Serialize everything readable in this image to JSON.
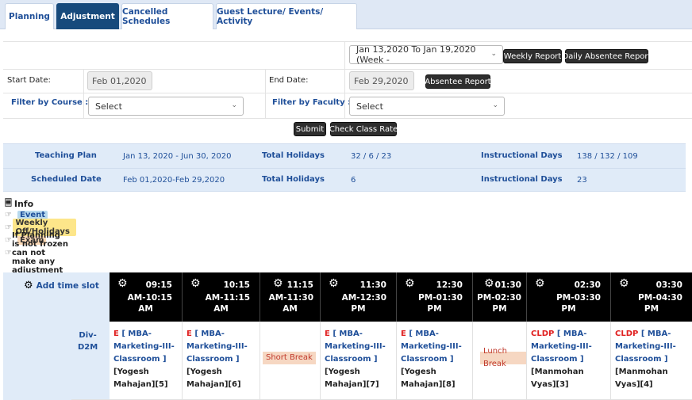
{
  "tabs": [
    {
      "label": "Planning",
      "active": false
    },
    {
      "label": "Adjustment",
      "active": true
    },
    {
      "label": "Cancelled Schedules",
      "active": false
    },
    {
      "label": "Guest Lecture/ Events/ Activity",
      "active": false
    }
  ],
  "week": {
    "selected": "Jan 13,2020 To Jan 19,2020 (Week -"
  },
  "buttons": {
    "weekly_report": "Weekly Report",
    "daily_absentee_report": "Daily Absentee Report",
    "absentee_report": "Absentee Report",
    "submit": "Submit",
    "check_class_rate": "Check Class Rate"
  },
  "dates": {
    "start_label": "Start Date:",
    "start_value": "Feb 01,2020",
    "end_label": "End Date:",
    "end_value": "Feb 29,2020"
  },
  "filters": {
    "course_label": "Filter by Course :",
    "course_value": "Select",
    "faculty_label": "Filter by Faculty :",
    "faculty_value": "Select"
  },
  "summary": {
    "r1": {
      "label1": "Teaching Plan",
      "value1": "Jan 13, 2020 - Jun 30, 2020",
      "label2": "Total Holidays",
      "value2": "32 / 6 / 23",
      "label3": "Instructional Days",
      "value3": "138 / 132 / 109"
    },
    "r2": {
      "label1": "Scheduled Date",
      "value1": "Feb 01,2020-Feb 29,2020",
      "label2": "Total Holidays",
      "value2": "6",
      "label3": "Instructional Days",
      "value3": "23"
    }
  },
  "info": {
    "title": "Info",
    "items": [
      "Event",
      "Weekly Off/Holidays",
      "Exam",
      "If Planning is not frozen can not make any adjustment"
    ]
  },
  "timetable": {
    "add_slot": "Add time slot",
    "slots": [
      {
        "time": "09:15",
        "time2": "AM-10:15",
        "ampm": "AM"
      },
      {
        "time": "10:15",
        "time2": "AM-11:15",
        "ampm": "AM"
      },
      {
        "time": "11:15",
        "time2": "AM-11:30",
        "ampm": "AM"
      },
      {
        "time": "11:30",
        "time2": "AM-12:30",
        "ampm": "PM"
      },
      {
        "time": "12:30",
        "time2": "PM-01:30",
        "ampm": "PM"
      },
      {
        "time": "01:30",
        "time2": "PM-02:30",
        "ampm": "PM"
      },
      {
        "time": "02:30",
        "time2": "PM-03:30",
        "ampm": "PM"
      },
      {
        "time": "03:30",
        "time2": "PM-04:30",
        "ampm": "PM"
      }
    ],
    "division": {
      "line1": "Div-",
      "line2": "D2M"
    },
    "cells": [
      {
        "code": "E",
        "l1": " [ MBA-",
        "l2": "Marketing-III-",
        "l3": "Classroom ]",
        "l4": "[Yogesh",
        "l5": "Mahajan][5]"
      },
      {
        "code": "E",
        "l1": " [ MBA-",
        "l2": "Marketing-III-",
        "l3": "Classroom ]",
        "l4": "[Yogesh",
        "l5": "Mahajan][6]"
      },
      {
        "break": "Short Break"
      },
      {
        "code": "E",
        "l1": " [ MBA-",
        "l2": "Marketing-III-",
        "l3": "Classroom ]",
        "l4": "[Yogesh",
        "l5": "Mahajan][7]"
      },
      {
        "code": "E",
        "l1": " [ MBA-",
        "l2": "Marketing-III-",
        "l3": "Classroom ]",
        "l4": "[Yogesh",
        "l5": "Mahajan][8]"
      },
      {
        "break": "Lunch Break"
      },
      {
        "code": "CLDP",
        "l1": " [ MBA-",
        "l2": "Marketing-III-",
        "l3": "Classroom ]",
        "l4": "[Manmohan",
        "l5": "Vyas][3]"
      },
      {
        "code": "CLDP",
        "l1": " [ MBA-",
        "l2": "Marketing-III-",
        "l3": "Classroom ]",
        "l4": "[Manmohan",
        "l5": "Vyas][4]"
      }
    ]
  },
  "colors": {
    "accent": "#174a7c",
    "link": "#1f4f99",
    "band": "#e0ebf8",
    "event": "#b7d9ee",
    "holiday": "#fde68a",
    "exam": "#fcd9b6"
  },
  "icons": {
    "gear": "gear-icon",
    "hand": "pointing-hand-icon",
    "info": "info-icon",
    "chevron": "chevron-down-icon"
  }
}
